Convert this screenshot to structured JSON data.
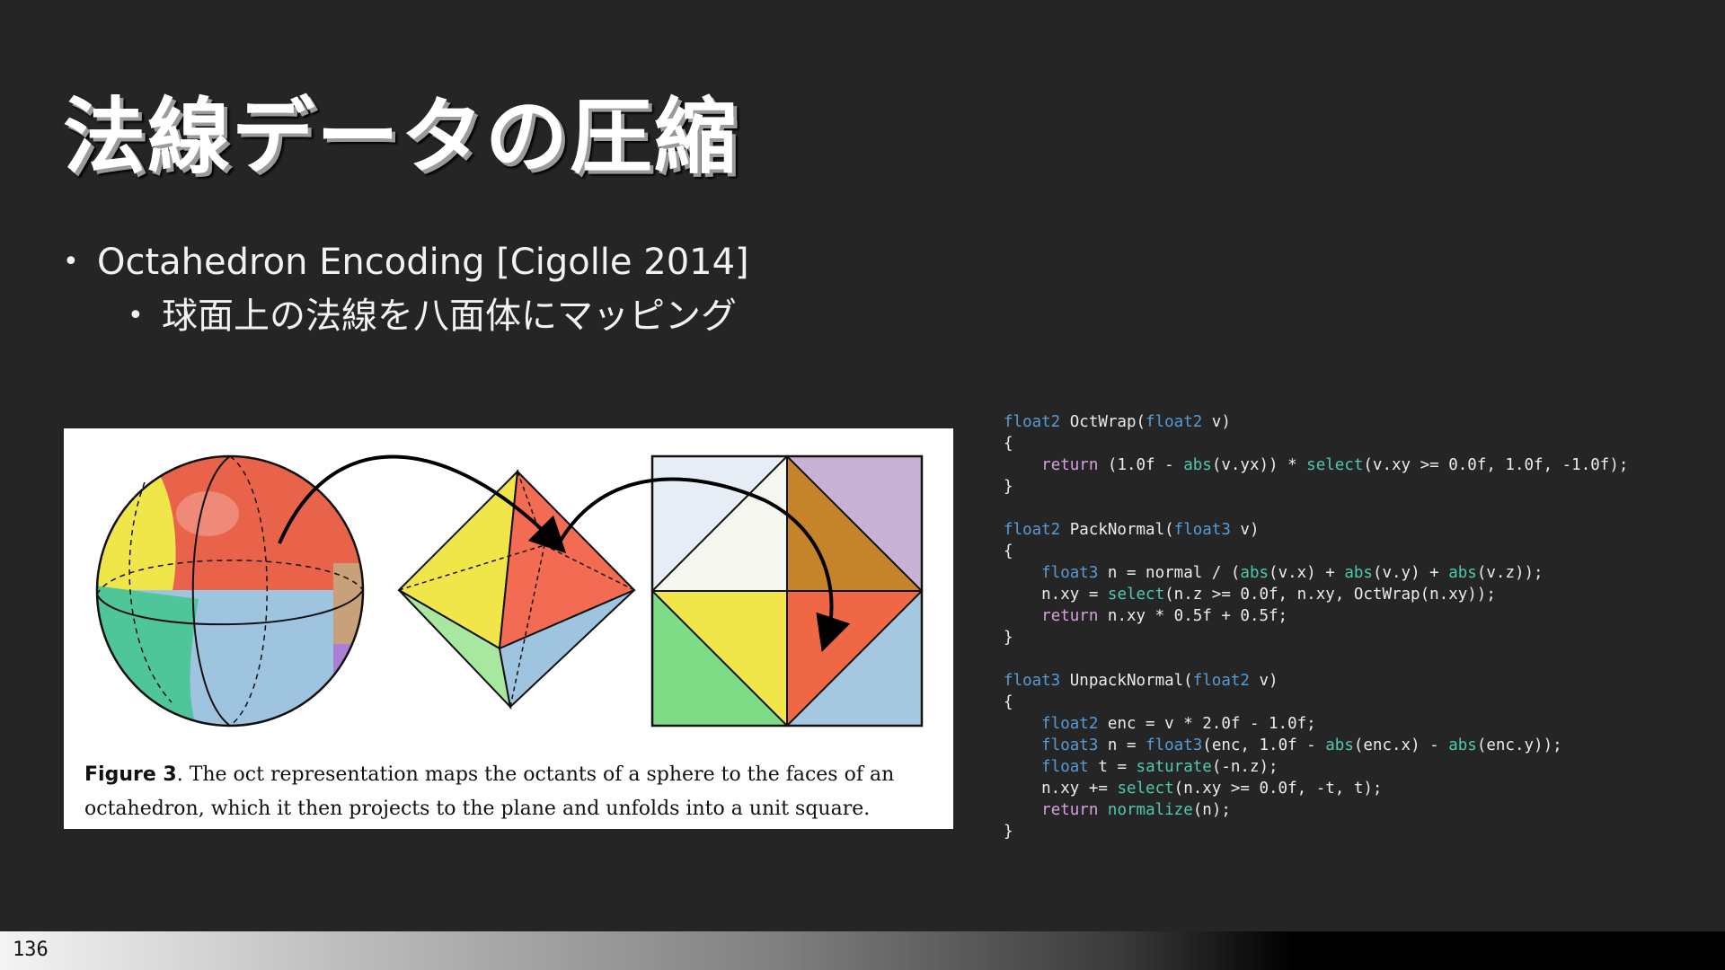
{
  "slide": {
    "title": "法線データの圧縮",
    "bullets": [
      {
        "text": "Octahedron Encoding [Cigolle 2014]"
      },
      {
        "text": "球面上の法線を八面体にマッピング"
      }
    ],
    "figure": {
      "label": "Figure 3",
      "caption": ".  The oct representation maps the octants of a sphere to the faces of an octahedron, which it then projects to the plane and unfolds into a unit square."
    },
    "page_number": "136"
  },
  "code": {
    "lines": [
      [
        {
          "t": "float2",
          "c": "type"
        },
        {
          "t": " OctWrap("
        },
        {
          "t": "float2",
          "c": "type"
        },
        {
          "t": " v)"
        }
      ],
      [
        {
          "t": "{"
        }
      ],
      [
        {
          "t": "    "
        },
        {
          "t": "return",
          "c": "kw"
        },
        {
          "t": " (1.0f - "
        },
        {
          "t": "abs",
          "c": "fn"
        },
        {
          "t": "(v.yx)) * "
        },
        {
          "t": "select",
          "c": "fn"
        },
        {
          "t": "(v.xy >= 0.0f, 1.0f, -1.0f);"
        }
      ],
      [
        {
          "t": "}"
        }
      ],
      [],
      [
        {
          "t": "float2",
          "c": "type"
        },
        {
          "t": " PackNormal("
        },
        {
          "t": "float3",
          "c": "type"
        },
        {
          "t": " v)"
        }
      ],
      [
        {
          "t": "{"
        }
      ],
      [
        {
          "t": "    "
        },
        {
          "t": "float3",
          "c": "type"
        },
        {
          "t": " n = normal / ("
        },
        {
          "t": "abs",
          "c": "fn"
        },
        {
          "t": "(v.x) + "
        },
        {
          "t": "abs",
          "c": "fn"
        },
        {
          "t": "(v.y) + "
        },
        {
          "t": "abs",
          "c": "fn"
        },
        {
          "t": "(v.z));"
        }
      ],
      [
        {
          "t": "    n.xy = "
        },
        {
          "t": "select",
          "c": "fn"
        },
        {
          "t": "(n.z >= 0.0f, n.xy, OctWrap(n.xy));"
        }
      ],
      [
        {
          "t": "    "
        },
        {
          "t": "return",
          "c": "kw"
        },
        {
          "t": " n.xy * 0.5f + 0.5f;"
        }
      ],
      [
        {
          "t": "}"
        }
      ],
      [],
      [
        {
          "t": "float3",
          "c": "type"
        },
        {
          "t": " UnpackNormal("
        },
        {
          "t": "float2",
          "c": "type"
        },
        {
          "t": " v)"
        }
      ],
      [
        {
          "t": "{"
        }
      ],
      [
        {
          "t": "    "
        },
        {
          "t": "float2",
          "c": "type"
        },
        {
          "t": " enc = v * 2.0f - 1.0f;"
        }
      ],
      [
        {
          "t": "    "
        },
        {
          "t": "float3",
          "c": "type"
        },
        {
          "t": " n = "
        },
        {
          "t": "float3",
          "c": "type"
        },
        {
          "t": "(enc, 1.0f - "
        },
        {
          "t": "abs",
          "c": "fn"
        },
        {
          "t": "(enc.x) - "
        },
        {
          "t": "abs",
          "c": "fn"
        },
        {
          "t": "(enc.y));"
        }
      ],
      [
        {
          "t": "    "
        },
        {
          "t": "float",
          "c": "type"
        },
        {
          "t": " t = "
        },
        {
          "t": "saturate",
          "c": "fn"
        },
        {
          "t": "(-n.z);"
        }
      ],
      [
        {
          "t": "    n.xy += "
        },
        {
          "t": "select",
          "c": "fn"
        },
        {
          "t": "(n.xy >= 0.0f, -t, t);"
        }
      ],
      [
        {
          "t": "    "
        },
        {
          "t": "return",
          "c": "kw"
        },
        {
          "t": " "
        },
        {
          "t": "normalize",
          "c": "fn"
        },
        {
          "t": "(n);"
        }
      ],
      [
        {
          "t": "}"
        }
      ]
    ]
  },
  "colors": {
    "background": "#252525",
    "code_type": "#569cd6",
    "code_keyword": "#d8a0df",
    "code_function": "#4ec9b0",
    "face_red": "#e8634a",
    "face_yellow": "#f0e64a",
    "face_green": "#7ddc85",
    "face_blue": "#9fc4e0",
    "face_orange": "#c5832a",
    "face_lilac": "#c7b2d5",
    "face_white": "#f7f7f2",
    "face_lightblue": "#e6edf4"
  }
}
